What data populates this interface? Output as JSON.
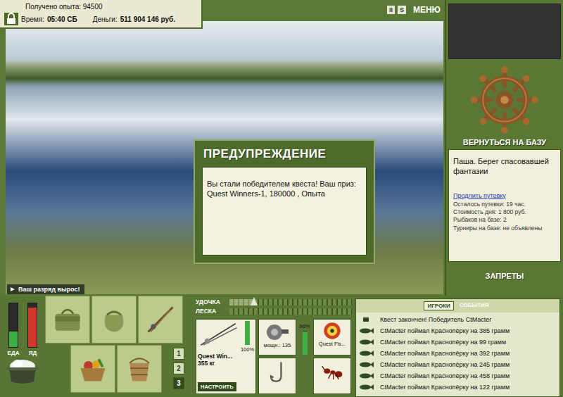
{
  "header": {
    "experience": "Получено опыта: 94500",
    "time_label": "Время:",
    "time": "05:40 СБ",
    "money_label": "Деньги:",
    "money": "511 904 146 руб."
  },
  "top_buttons": [
    {
      "label": "II"
    },
    {
      "label": "S"
    },
    {
      "label": "МЕНЮ"
    }
  ],
  "dialog": {
    "title": "ПРЕДУПРЕЖДЕНИЕ",
    "message": "Вы стали победителем квеста! Ваш приз: Quest Winners-1, 180000 , Опыта"
  },
  "notice": "Ваш разряд вырос!",
  "sidebar": {
    "return_label": "ВЕРНУТЬСЯ НА БАЗУ",
    "location": "Паша. Берег спасовавшей фантазии",
    "extend_link": "Продлить путевку",
    "info": [
      "Осталось путевки: 19 час.",
      "Стоимость дня: 1 800 руб.",
      "Рыбаков на базе: 2",
      "Турниры на базе: не объявлены"
    ],
    "bans_label": "ЗАПРЕТЫ"
  },
  "meters": [
    {
      "name": "ЕДА",
      "level": 0.35,
      "color": "#3cb043"
    },
    {
      "name": "ЯД",
      "level": 0.9,
      "color": "#d0392a"
    }
  ],
  "pages": [
    {
      "label": "1",
      "selected": false
    },
    {
      "label": "2",
      "selected": false
    },
    {
      "label": "3",
      "selected": true
    }
  ],
  "tension": [
    {
      "label": "УДОЧКА",
      "level": 0.2
    },
    {
      "label": "ЛЕСКА",
      "level": 0
    }
  ],
  "tackle": {
    "rod": {
      "name": "Quest Win...",
      "weight": "355 кг",
      "condition": "100%",
      "level": 1
    },
    "setup_button": "НАСТРОИТЬ",
    "reel": {
      "power": "мощн.: 135",
      "condition": "96%",
      "level": 0.96
    },
    "line": {
      "name": "Quest Fis..."
    }
  },
  "log": {
    "tabs": [
      {
        "label": "ИГРОКИ",
        "selected": true
      },
      {
        "label": "СОБЫТИЯ",
        "selected": false
      }
    ],
    "entries": [
      {
        "text": "Квест закончен! Победитель CtMacter",
        "kind": "event"
      },
      {
        "text": "CtMacter поймал Краснопёрку на 385 грамм",
        "kind": "catch"
      },
      {
        "text": "CtMacter поймал Краснопёрку на 99 грамм",
        "kind": "catch"
      },
      {
        "text": "CtMacter поймал Краснопёрку на 392 грамм",
        "kind": "catch"
      },
      {
        "text": "CtMacter поймал Краснопёрку на 245 грамм",
        "kind": "catch"
      },
      {
        "text": "CtMacter поймал Краснопёрку на 458 грамм",
        "kind": "catch"
      },
      {
        "text": "CtMacter поймал Краснопёрку на 122 грамм",
        "kind": "catch"
      }
    ]
  }
}
